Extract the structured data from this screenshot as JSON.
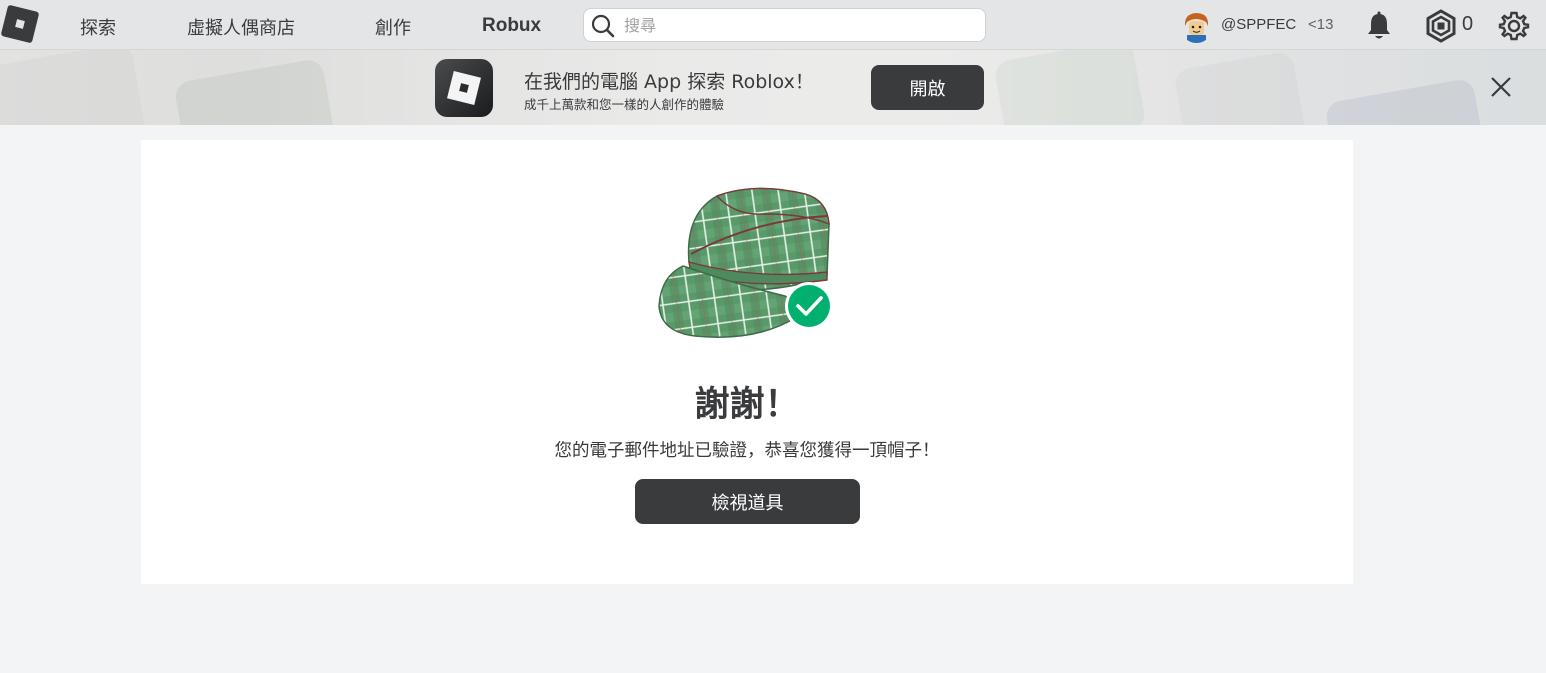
{
  "nav": {
    "links": [
      "探索",
      "虛擬人偶商店",
      "創作",
      "Robux"
    ],
    "search_placeholder": "搜尋",
    "username": "@SPPFEC",
    "age_badge": "<13",
    "robux_balance": "0"
  },
  "banner": {
    "title": "在我們的電腦 App 探索 Roblox！",
    "subtitle": "成千上萬款和您一樣的人創作的體驗",
    "open_label": "開啟"
  },
  "main": {
    "title": "謝謝！",
    "message": "您的電子郵件地址已驗證，恭喜您獲得一頂帽子！",
    "view_item_label": "檢視道具"
  },
  "colors": {
    "accent_dark": "#393b3d",
    "success_green": "#00b06f",
    "hat_green": "#5a9a6a"
  }
}
